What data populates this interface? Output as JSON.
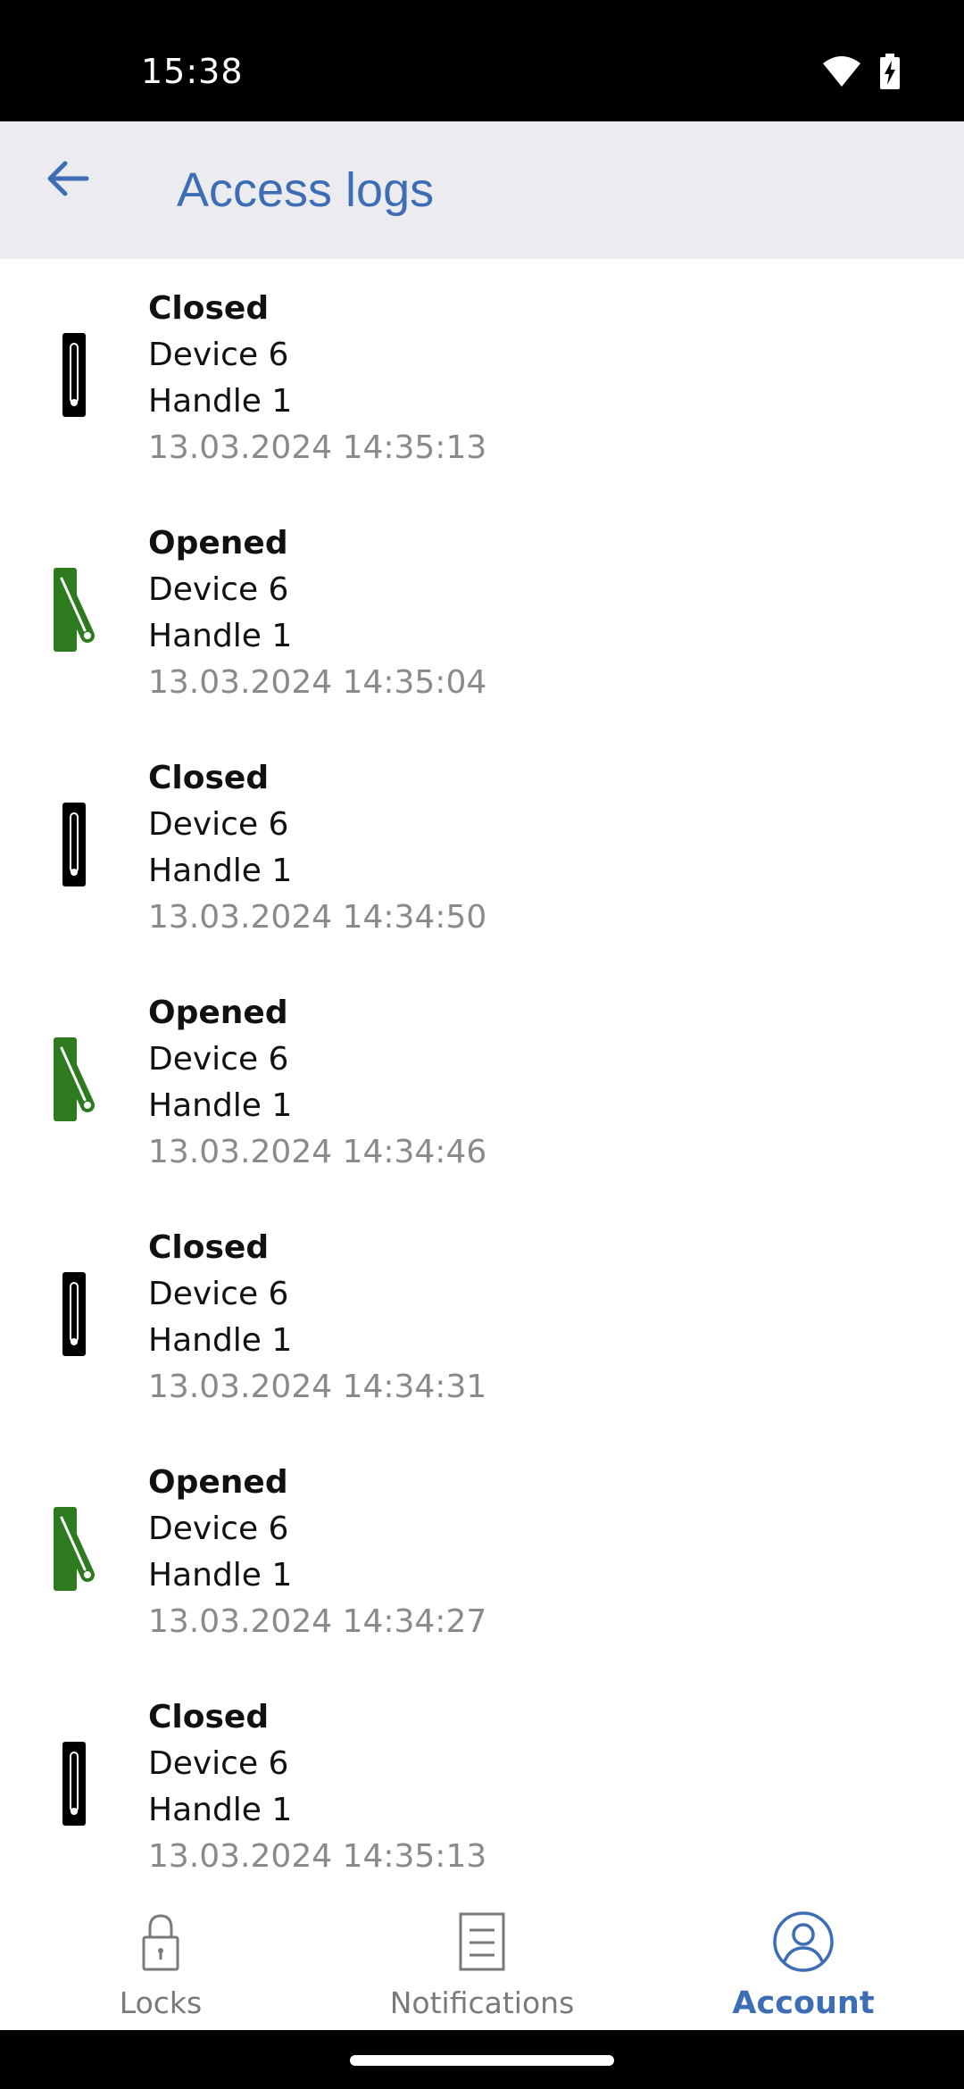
{
  "status_bar": {
    "time": "15:38",
    "icons": [
      "wifi-icon",
      "battery-charging-icon"
    ]
  },
  "app_bar": {
    "back_icon": "arrow-left-icon",
    "title": "Access logs"
  },
  "colors": {
    "accent": "#3d6db5",
    "app_bar_bg": "#ececf0",
    "closed_icon": "#000000",
    "opened_icon": "#2d7a1f",
    "timestamp": "#8a8a8a"
  },
  "logs": [
    {
      "status": "Closed",
      "device": "Device 6",
      "handle": "Handle 1",
      "timestamp": "13.03.2024 14:35:13",
      "icon": "handle-closed-icon"
    },
    {
      "status": "Opened",
      "device": "Device 6",
      "handle": "Handle 1",
      "timestamp": "13.03.2024 14:35:04",
      "icon": "handle-opened-icon"
    },
    {
      "status": "Closed",
      "device": "Device 6",
      "handle": "Handle 1",
      "timestamp": "13.03.2024 14:34:50",
      "icon": "handle-closed-icon"
    },
    {
      "status": "Opened",
      "device": "Device 6",
      "handle": "Handle 1",
      "timestamp": "13.03.2024 14:34:46",
      "icon": "handle-opened-icon"
    },
    {
      "status": "Closed",
      "device": "Device 6",
      "handle": "Handle 1",
      "timestamp": "13.03.2024 14:34:31",
      "icon": "handle-closed-icon"
    },
    {
      "status": "Opened",
      "device": "Device 6",
      "handle": "Handle 1",
      "timestamp": "13.03.2024 14:34:27",
      "icon": "handle-opened-icon"
    },
    {
      "status": "Closed",
      "device": "Device 6",
      "handle": "Handle 1",
      "timestamp": "13.03.2024 14:35:13",
      "icon": "handle-closed-icon"
    }
  ],
  "bottom_nav": {
    "items": [
      {
        "label": "Locks",
        "icon": "lock-icon",
        "active": false
      },
      {
        "label": "Notifications",
        "icon": "document-icon",
        "active": false
      },
      {
        "label": "Account",
        "icon": "account-icon",
        "active": true
      }
    ]
  }
}
